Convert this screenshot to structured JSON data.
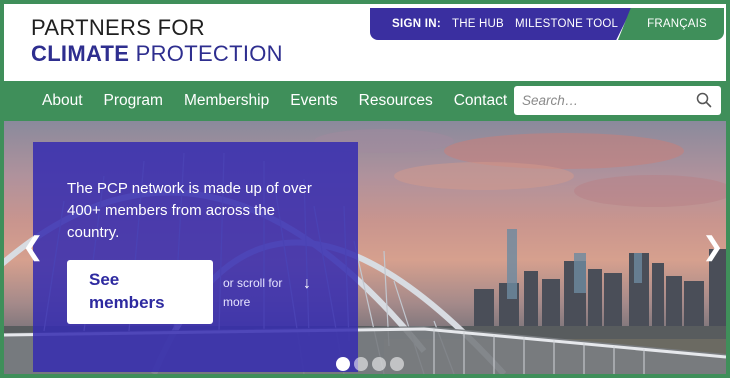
{
  "header": {
    "logo_line1": "PARTNERS FOR",
    "logo_line2_bold": "CLIMATE",
    "logo_line2_rest": " PROTECTION"
  },
  "topbar": {
    "signin_label": "SIGN IN:",
    "links": [
      "THE HUB",
      "MILESTONE TOOL"
    ],
    "language": "FRANÇAIS"
  },
  "nav": {
    "items": [
      "About",
      "Program",
      "Membership",
      "Events",
      "Resources",
      "Contact"
    ],
    "search_placeholder": "Search…"
  },
  "hero": {
    "text": "The PCP network is made up of over 400+ members from across the country.",
    "button_line1": "See",
    "button_line2": "members",
    "scroll_text": "or scroll for more",
    "scroll_arrow": "↓",
    "prev_arrow": "❮",
    "next_arrow": "❯",
    "carousel_slides": 4,
    "active_slide": 1
  },
  "colors": {
    "brand_green": "#3f8f5a",
    "brand_purple": "#3a2fa0",
    "logo_blue": "#2e2e8f"
  }
}
